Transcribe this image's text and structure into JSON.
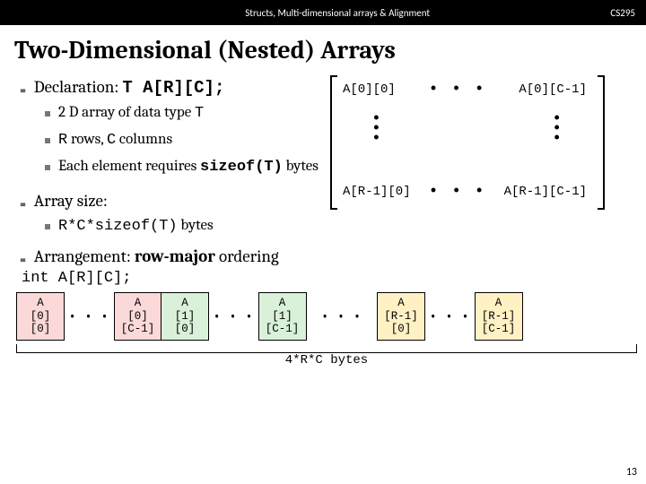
{
  "header": {
    "topic": "Structs, Multi-dimensional arrays & Alignment",
    "course": "CS295"
  },
  "title": "Two-Dimensional (Nested) Arrays",
  "main": {
    "declaration": {
      "label": "Declaration:",
      "code": "T A[R][C];",
      "subs": [
        {
          "pre": "2 D array of data type ",
          "code": "T",
          "post": ""
        },
        {
          "pre": "",
          "code": "R",
          "mid": " rows, ",
          "code2": "C",
          "post": " columns"
        },
        {
          "pre": "Each element requires ",
          "code": "sizeof(T)",
          "post": "  bytes"
        }
      ]
    },
    "arraysize": {
      "label": "Array size:",
      "sub": {
        "code": "R*C*sizeof(T)",
        "post": " bytes"
      }
    },
    "arrangement": {
      "label": "Arrangement:",
      "bold": "row-major",
      "post": " ordering"
    }
  },
  "matrix": {
    "tl": "A[0][0]",
    "tr": "A[0][C-1]",
    "bl": "A[R-1][0]",
    "br": "A[R-1][C-1]",
    "dots": "• • •"
  },
  "decl_line": "int A[R][C];",
  "layout": {
    "cells": [
      {
        "c": "A\n[0]\n[0]",
        "cls": "row0"
      },
      {
        "dots": true
      },
      {
        "c": "A\n[0]\n[C-1]",
        "cls": "row0"
      },
      {
        "c": "A\n[1]\n[0]",
        "cls": "row1"
      },
      {
        "dots": true
      },
      {
        "c": "A\n[1]\n[C-1]",
        "cls": "row1"
      },
      {
        "dots": true,
        "wide": true
      },
      {
        "c": "A\n[R-1]\n[0]",
        "cls": "rowR"
      },
      {
        "dots": true
      },
      {
        "c": "A\n[R-1]\n[C-1]",
        "cls": "rowR"
      }
    ],
    "brace_label": "4*R*C  bytes"
  },
  "page_number": "13"
}
